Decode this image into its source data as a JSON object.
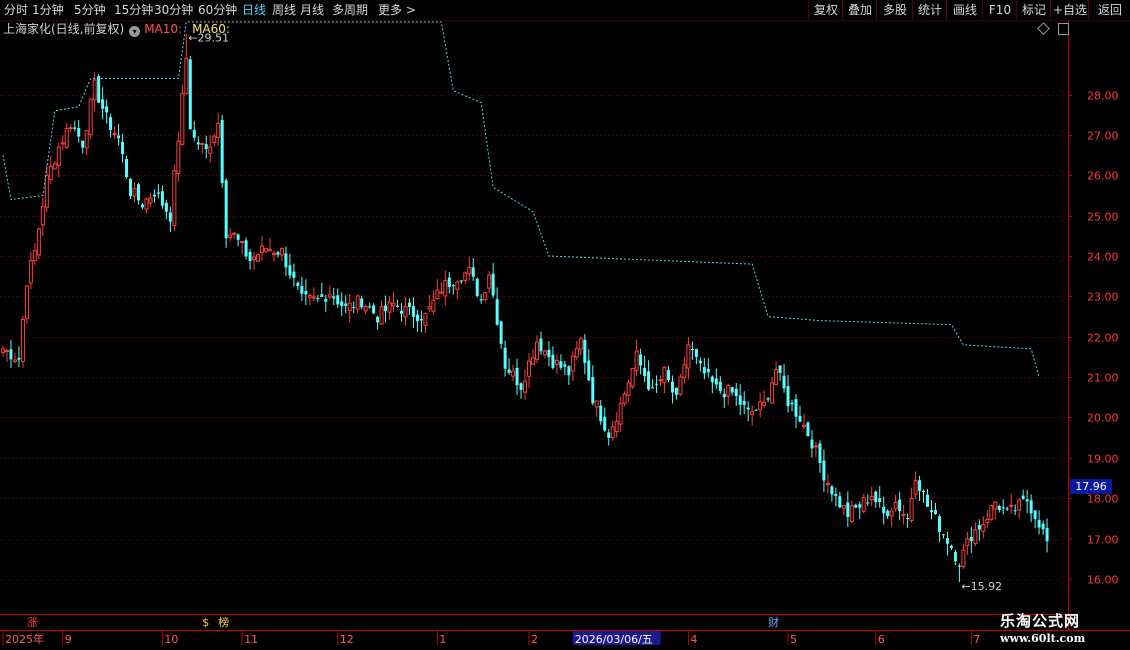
{
  "toolbar": {
    "periods": [
      {
        "label": "分时",
        "active": false
      },
      {
        "label": "1分钟",
        "active": false
      },
      {
        "label": "5分钟",
        "active": false
      },
      {
        "label": "15分钟",
        "active": false
      },
      {
        "label": "30分钟",
        "active": false
      },
      {
        "label": "60分钟",
        "active": false
      },
      {
        "label": "日线",
        "active": true
      },
      {
        "label": "周线",
        "active": false
      },
      {
        "label": "月线",
        "active": false
      },
      {
        "label": "多周期",
        "active": false
      }
    ],
    "more": "更多 >",
    "right_buttons": [
      "复权",
      "叠加",
      "多股",
      "统计",
      "画线",
      "F10",
      "标记",
      "+自选",
      "返回"
    ]
  },
  "header": {
    "stock_name": "上海家化(日线,前复权)",
    "ma10_label": "MA10:",
    "ma60_label": "MA60:"
  },
  "current_price": "17.96",
  "watermark": {
    "line1": "乐淘公式网",
    "line2": "www.60lt.com"
  },
  "colors": {
    "up": "#ff3c3c",
    "down": "#54ffff",
    "ma60": "#4fd8e8",
    "grid": "#7a0000",
    "axis": "#c00000",
    "current_price_bg": "#0a1aa0"
  },
  "chart_data": {
    "type": "candlestick",
    "ylim": [
      15.6,
      29.8
    ],
    "y_ticks": [
      "16.00",
      "17.00",
      "18.00",
      "19.00",
      "20.00",
      "21.00",
      "22.00",
      "23.00",
      "24.00",
      "25.00",
      "26.00",
      "27.00",
      "28.00"
    ],
    "high_label": "29.51",
    "low_label": "15.92",
    "x_labels": [
      "2025年",
      "9",
      "10",
      "11",
      "12",
      "1",
      "2",
      "3",
      "2026/03/06/五",
      "4",
      "5",
      "6",
      "7"
    ],
    "x_label_index": [
      0,
      15,
      40,
      60,
      84,
      109,
      132,
      148,
      153,
      172,
      197,
      219,
      243
    ],
    "markers": [
      {
        "text": "涨",
        "index": 7,
        "color": "#ff3c3c"
      },
      {
        "text": "$",
        "index": 51,
        "color": "#ffcc33"
      },
      {
        "text": "榜",
        "index": 55,
        "color": "#ffcc33"
      },
      {
        "text": "财",
        "index": 193,
        "color": "#6aa8ff"
      }
    ],
    "close_anchors": [
      [
        0,
        21.7
      ],
      [
        4,
        21.45
      ],
      [
        6,
        23.4
      ],
      [
        8,
        24.1
      ],
      [
        11,
        25.9
      ],
      [
        14,
        26.7
      ],
      [
        17,
        27.3
      ],
      [
        20,
        26.8
      ],
      [
        23,
        28.2
      ],
      [
        26,
        27.4
      ],
      [
        29,
        26.9
      ],
      [
        32,
        25.6
      ],
      [
        35,
        25.3
      ],
      [
        38,
        25.6
      ],
      [
        42,
        25.0
      ],
      [
        45,
        27.9
      ],
      [
        48,
        26.9
      ],
      [
        51,
        26.6
      ],
      [
        54,
        27.3
      ],
      [
        56,
        24.6
      ],
      [
        58,
        24.5
      ],
      [
        62,
        23.9
      ],
      [
        66,
        24.2
      ],
      [
        70,
        24.1
      ],
      [
        72,
        23.6
      ],
      [
        75,
        22.9
      ],
      [
        79,
        22.9
      ],
      [
        82,
        23.1
      ],
      [
        86,
        22.7
      ],
      [
        90,
        22.9
      ],
      [
        94,
        22.5
      ],
      [
        98,
        22.8
      ],
      [
        102,
        22.6
      ],
      [
        106,
        22.5
      ],
      [
        110,
        23.2
      ],
      [
        114,
        23.5
      ],
      [
        117,
        23.6
      ],
      [
        120,
        22.9
      ],
      [
        122,
        23.6
      ],
      [
        126,
        21.3
      ],
      [
        130,
        20.8
      ],
      [
        134,
        21.9
      ],
      [
        138,
        21.4
      ],
      [
        142,
        21.1
      ],
      [
        145,
        21.9
      ],
      [
        148,
        20.5
      ],
      [
        152,
        19.6
      ],
      [
        155,
        20.3
      ],
      [
        159,
        21.5
      ],
      [
        163,
        20.6
      ],
      [
        166,
        21.1
      ],
      [
        169,
        20.4
      ],
      [
        172,
        21.8
      ],
      [
        175,
        21.2
      ],
      [
        179,
        20.7
      ],
      [
        183,
        20.6
      ],
      [
        187,
        20.1
      ],
      [
        191,
        20.3
      ],
      [
        194,
        21.2
      ],
      [
        197,
        20.4
      ],
      [
        200,
        20.0
      ],
      [
        203,
        19.4
      ],
      [
        206,
        18.6
      ],
      [
        209,
        18.0
      ],
      [
        212,
        17.6
      ],
      [
        215,
        17.8
      ],
      [
        218,
        18.1
      ],
      [
        221,
        17.6
      ],
      [
        224,
        17.9
      ],
      [
        227,
        17.5
      ],
      [
        229,
        18.6
      ],
      [
        232,
        17.8
      ],
      [
        235,
        17.3
      ],
      [
        238,
        16.8
      ],
      [
        240,
        16.4
      ],
      [
        243,
        17.1
      ],
      [
        246,
        17.4
      ],
      [
        249,
        17.9
      ],
      [
        252,
        17.6
      ],
      [
        255,
        17.8
      ],
      [
        257,
        17.95
      ],
      [
        260,
        17.4
      ],
      [
        262,
        16.9
      ]
    ],
    "ma60_steps": [
      [
        0,
        26.5
      ],
      [
        2,
        25.4
      ],
      [
        10,
        25.5
      ],
      [
        13,
        27.6
      ],
      [
        19,
        27.7
      ],
      [
        22,
        28.4
      ],
      [
        44,
        28.4
      ],
      [
        46,
        29.8
      ],
      [
        110,
        29.8
      ],
      [
        113,
        28.1
      ],
      [
        120,
        27.8
      ],
      [
        123,
        25.7
      ],
      [
        133,
        25.1
      ],
      [
        137,
        24.0
      ],
      [
        188,
        23.8
      ],
      [
        192,
        22.5
      ],
      [
        205,
        22.4
      ],
      [
        238,
        22.3
      ],
      [
        241,
        21.8
      ],
      [
        258,
        21.7
      ],
      [
        260,
        21.0
      ]
    ]
  }
}
